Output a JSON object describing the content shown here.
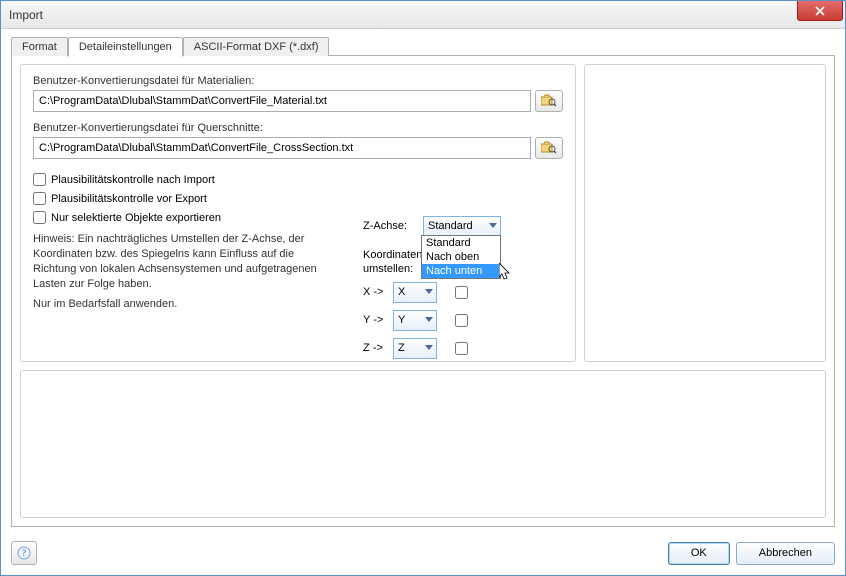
{
  "title": "Import",
  "tabs": {
    "format": "Format",
    "detail": "Detaileinstellungen",
    "ascii": "ASCII-Format DXF (*.dxf)"
  },
  "labels": {
    "matFile": "Benutzer-Konvertierungsdatei für Materialien:",
    "csFile": "Benutzer-Konvertierungsdatei für Querschnitte:",
    "plausAfter": "Plausibilitätskontrolle nach Import",
    "plausBefore": "Plausibilitätskontrolle vor Export",
    "exportSel": "Nur selektierte Objekte exportieren",
    "hint1": "Hinweis: Ein nachträgliches Umstellen der Z-Achse, der Koordinaten bzw. des Spiegelns kann Einfluss auf die Richtung von lokalen Achsensystemen und aufgetragenen Lasten zur Folge haben.",
    "hint2": "Nur im Bedarfsfall anwenden.",
    "zAxis": "Z-Achse:",
    "coordSwap": "Koordinaten umstellen:",
    "xTo": "X ->",
    "yTo": "Y ->",
    "zTo": "Z ->"
  },
  "paths": {
    "material": "C:\\ProgramData\\Dlubal\\StammDat\\ConvertFile_Material.txt",
    "crossSection": "C:\\ProgramData\\Dlubal\\StammDat\\ConvertFile_CrossSection.txt"
  },
  "zAxis": {
    "value": "Standard",
    "options": [
      "Standard",
      "Nach oben",
      "Nach unten"
    ],
    "highlighted": "Nach unten"
  },
  "coords": {
    "x": "X",
    "y": "Y",
    "z": "Z"
  },
  "buttons": {
    "ok": "OK",
    "cancel": "Abbrechen"
  }
}
